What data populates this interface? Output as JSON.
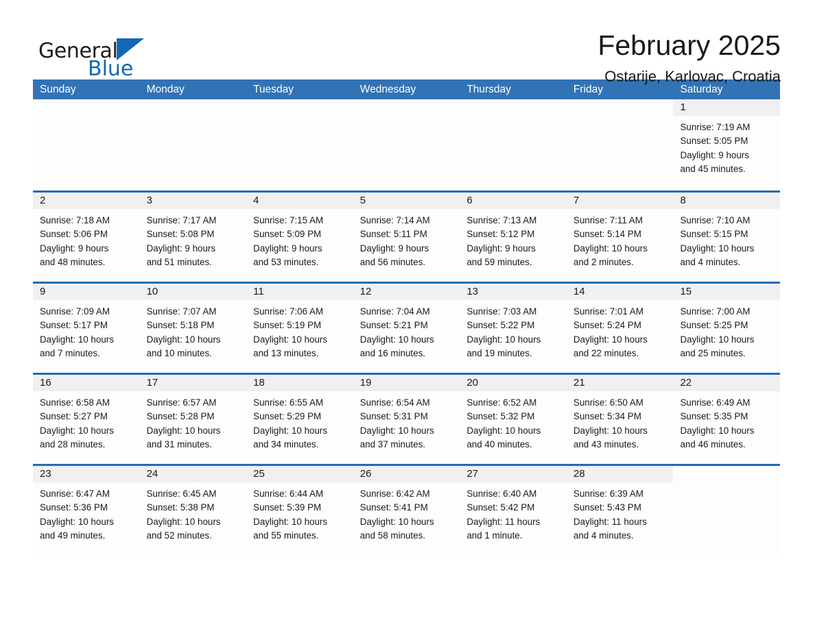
{
  "brand": {
    "word1": "General",
    "word2": "Blue",
    "mark": "triangle-logo",
    "accent_color": "#1268b3"
  },
  "header": {
    "month_title": "February 2025",
    "location": "Ostarije, Karlovac, Croatia"
  },
  "calendar": {
    "header_bg": "#3273b5",
    "row_border": "#1f6cb5",
    "daynumber_bg": "#f0f0f0",
    "weekdays": [
      "Sunday",
      "Monday",
      "Tuesday",
      "Wednesday",
      "Thursday",
      "Friday",
      "Saturday"
    ],
    "weeks": [
      [
        {
          "day": "",
          "blank": true,
          "lines": []
        },
        {
          "day": "",
          "blank": true,
          "lines": []
        },
        {
          "day": "",
          "blank": true,
          "lines": []
        },
        {
          "day": "",
          "blank": true,
          "lines": []
        },
        {
          "day": "",
          "blank": true,
          "lines": []
        },
        {
          "day": "",
          "blank": true,
          "lines": []
        },
        {
          "day": "1",
          "blank": false,
          "lines": [
            "Sunrise: 7:19 AM",
            "Sunset: 5:05 PM",
            "Daylight: 9 hours",
            "and 45 minutes."
          ]
        }
      ],
      [
        {
          "day": "2",
          "blank": false,
          "lines": [
            "Sunrise: 7:18 AM",
            "Sunset: 5:06 PM",
            "Daylight: 9 hours",
            "and 48 minutes."
          ]
        },
        {
          "day": "3",
          "blank": false,
          "lines": [
            "Sunrise: 7:17 AM",
            "Sunset: 5:08 PM",
            "Daylight: 9 hours",
            "and 51 minutes."
          ]
        },
        {
          "day": "4",
          "blank": false,
          "lines": [
            "Sunrise: 7:15 AM",
            "Sunset: 5:09 PM",
            "Daylight: 9 hours",
            "and 53 minutes."
          ]
        },
        {
          "day": "5",
          "blank": false,
          "lines": [
            "Sunrise: 7:14 AM",
            "Sunset: 5:11 PM",
            "Daylight: 9 hours",
            "and 56 minutes."
          ]
        },
        {
          "day": "6",
          "blank": false,
          "lines": [
            "Sunrise: 7:13 AM",
            "Sunset: 5:12 PM",
            "Daylight: 9 hours",
            "and 59 minutes."
          ]
        },
        {
          "day": "7",
          "blank": false,
          "lines": [
            "Sunrise: 7:11 AM",
            "Sunset: 5:14 PM",
            "Daylight: 10 hours",
            "and 2 minutes."
          ]
        },
        {
          "day": "8",
          "blank": false,
          "lines": [
            "Sunrise: 7:10 AM",
            "Sunset: 5:15 PM",
            "Daylight: 10 hours",
            "and 4 minutes."
          ]
        }
      ],
      [
        {
          "day": "9",
          "blank": false,
          "lines": [
            "Sunrise: 7:09 AM",
            "Sunset: 5:17 PM",
            "Daylight: 10 hours",
            "and 7 minutes."
          ]
        },
        {
          "day": "10",
          "blank": false,
          "lines": [
            "Sunrise: 7:07 AM",
            "Sunset: 5:18 PM",
            "Daylight: 10 hours",
            "and 10 minutes."
          ]
        },
        {
          "day": "11",
          "blank": false,
          "lines": [
            "Sunrise: 7:06 AM",
            "Sunset: 5:19 PM",
            "Daylight: 10 hours",
            "and 13 minutes."
          ]
        },
        {
          "day": "12",
          "blank": false,
          "lines": [
            "Sunrise: 7:04 AM",
            "Sunset: 5:21 PM",
            "Daylight: 10 hours",
            "and 16 minutes."
          ]
        },
        {
          "day": "13",
          "blank": false,
          "lines": [
            "Sunrise: 7:03 AM",
            "Sunset: 5:22 PM",
            "Daylight: 10 hours",
            "and 19 minutes."
          ]
        },
        {
          "day": "14",
          "blank": false,
          "lines": [
            "Sunrise: 7:01 AM",
            "Sunset: 5:24 PM",
            "Daylight: 10 hours",
            "and 22 minutes."
          ]
        },
        {
          "day": "15",
          "blank": false,
          "lines": [
            "Sunrise: 7:00 AM",
            "Sunset: 5:25 PM",
            "Daylight: 10 hours",
            "and 25 minutes."
          ]
        }
      ],
      [
        {
          "day": "16",
          "blank": false,
          "lines": [
            "Sunrise: 6:58 AM",
            "Sunset: 5:27 PM",
            "Daylight: 10 hours",
            "and 28 minutes."
          ]
        },
        {
          "day": "17",
          "blank": false,
          "lines": [
            "Sunrise: 6:57 AM",
            "Sunset: 5:28 PM",
            "Daylight: 10 hours",
            "and 31 minutes."
          ]
        },
        {
          "day": "18",
          "blank": false,
          "lines": [
            "Sunrise: 6:55 AM",
            "Sunset: 5:29 PM",
            "Daylight: 10 hours",
            "and 34 minutes."
          ]
        },
        {
          "day": "19",
          "blank": false,
          "lines": [
            "Sunrise: 6:54 AM",
            "Sunset: 5:31 PM",
            "Daylight: 10 hours",
            "and 37 minutes."
          ]
        },
        {
          "day": "20",
          "blank": false,
          "lines": [
            "Sunrise: 6:52 AM",
            "Sunset: 5:32 PM",
            "Daylight: 10 hours",
            "and 40 minutes."
          ]
        },
        {
          "day": "21",
          "blank": false,
          "lines": [
            "Sunrise: 6:50 AM",
            "Sunset: 5:34 PM",
            "Daylight: 10 hours",
            "and 43 minutes."
          ]
        },
        {
          "day": "22",
          "blank": false,
          "lines": [
            "Sunrise: 6:49 AM",
            "Sunset: 5:35 PM",
            "Daylight: 10 hours",
            "and 46 minutes."
          ]
        }
      ],
      [
        {
          "day": "23",
          "blank": false,
          "lines": [
            "Sunrise: 6:47 AM",
            "Sunset: 5:36 PM",
            "Daylight: 10 hours",
            "and 49 minutes."
          ]
        },
        {
          "day": "24",
          "blank": false,
          "lines": [
            "Sunrise: 6:45 AM",
            "Sunset: 5:38 PM",
            "Daylight: 10 hours",
            "and 52 minutes."
          ]
        },
        {
          "day": "25",
          "blank": false,
          "lines": [
            "Sunrise: 6:44 AM",
            "Sunset: 5:39 PM",
            "Daylight: 10 hours",
            "and 55 minutes."
          ]
        },
        {
          "day": "26",
          "blank": false,
          "lines": [
            "Sunrise: 6:42 AM",
            "Sunset: 5:41 PM",
            "Daylight: 10 hours",
            "and 58 minutes."
          ]
        },
        {
          "day": "27",
          "blank": false,
          "lines": [
            "Sunrise: 6:40 AM",
            "Sunset: 5:42 PM",
            "Daylight: 11 hours",
            "and 1 minute."
          ]
        },
        {
          "day": "28",
          "blank": false,
          "lines": [
            "Sunrise: 6:39 AM",
            "Sunset: 5:43 PM",
            "Daylight: 11 hours",
            "and 4 minutes."
          ]
        },
        {
          "day": "",
          "blank": true,
          "lines": []
        }
      ]
    ]
  }
}
